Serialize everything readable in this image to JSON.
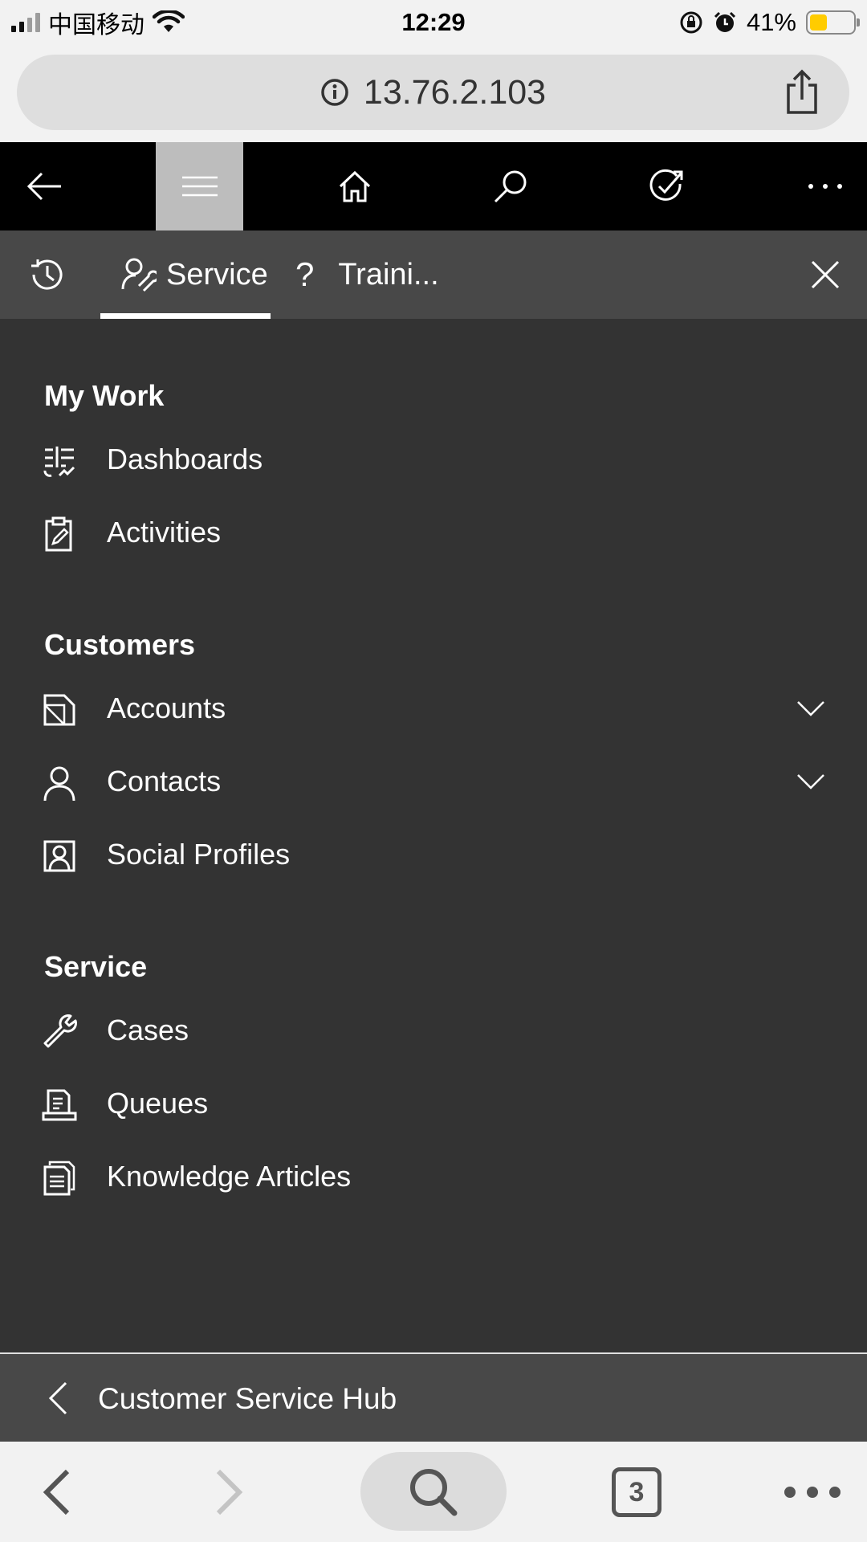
{
  "status_bar": {
    "carrier": "中国移动",
    "time": "12:29",
    "battery_percent": "41%",
    "battery_level": 0.41,
    "battery_color": "#ffcc00"
  },
  "browser": {
    "url": "13.76.2.103",
    "open_tabs_count": "3"
  },
  "top_nav": {
    "items": [
      "back-arrow-icon",
      "menu-icon",
      "home-icon",
      "search-icon",
      "task-icon",
      "more-icon"
    ]
  },
  "tabs": {
    "items": [
      {
        "icon": "recent-icon",
        "label": ""
      },
      {
        "icon": "service-icon",
        "label": "Service",
        "active": true
      },
      {
        "icon": "help-icon",
        "label": "Traini..."
      }
    ]
  },
  "sitemap": {
    "groups": [
      {
        "title": "My Work",
        "items": [
          {
            "label": "Dashboards",
            "icon": "dashboard-icon"
          },
          {
            "label": "Activities",
            "icon": "activities-icon"
          }
        ]
      },
      {
        "title": "Customers",
        "items": [
          {
            "label": "Accounts",
            "icon": "accounts-icon",
            "expandable": true
          },
          {
            "label": "Contacts",
            "icon": "contact-icon",
            "expandable": true
          },
          {
            "label": "Social Profiles",
            "icon": "social-profile-icon"
          }
        ]
      },
      {
        "title": "Service",
        "items": [
          {
            "label": "Cases",
            "icon": "wrench-icon"
          },
          {
            "label": "Queues",
            "icon": "queue-icon"
          },
          {
            "label": "Knowledge Articles",
            "icon": "knowledge-article-icon"
          }
        ]
      }
    ]
  },
  "area_switcher": {
    "label": "Customer Service Hub"
  },
  "colors": {
    "app_background": "#333333",
    "tab_strip": "#484848",
    "top_nav": "#000000",
    "active_nav": "#bdbdbd"
  }
}
